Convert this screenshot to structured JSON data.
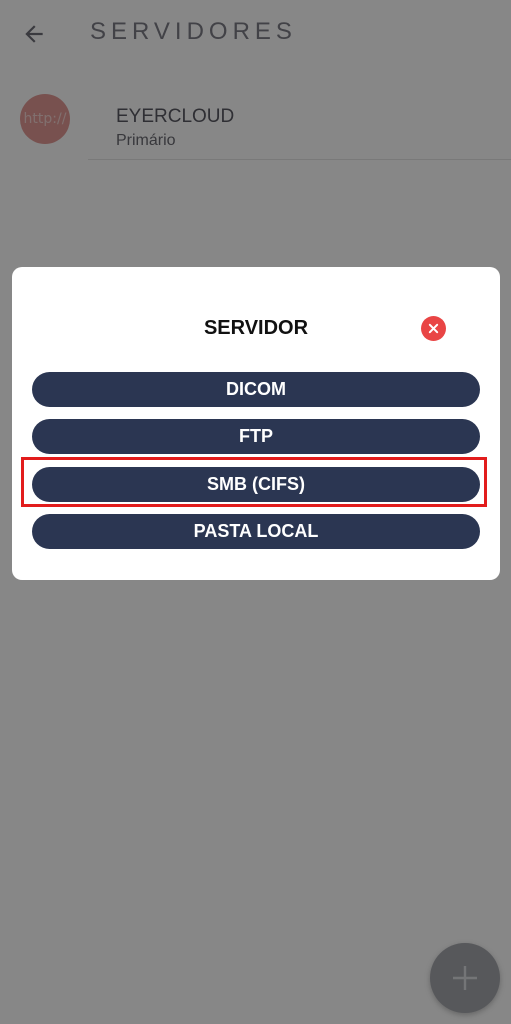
{
  "header": {
    "title": "SERVIDORES",
    "back_icon": "arrow-left-icon"
  },
  "server_list": {
    "items": [
      {
        "avatar_text": "http://",
        "name": "EYERCLOUD",
        "subtitle": "Primário"
      }
    ]
  },
  "dialog": {
    "title": "SERVIDOR",
    "close_icon": "close-icon",
    "options": [
      {
        "label": "DICOM"
      },
      {
        "label": "FTP"
      },
      {
        "label": "SMB (CIFS)"
      },
      {
        "label": "PASTA LOCAL"
      }
    ],
    "highlighted_option": "SMB (CIFS)"
  },
  "fab": {
    "icon": "plus-icon"
  },
  "colors": {
    "button_bg": "#2b3652",
    "close_bg": "#e94545",
    "highlight": "#e21c1c",
    "avatar_bg": "#e29a96"
  }
}
